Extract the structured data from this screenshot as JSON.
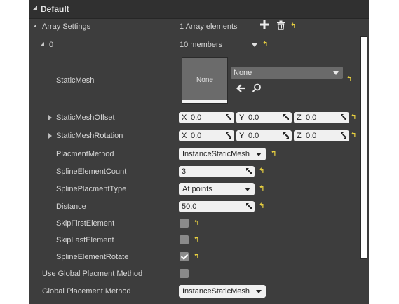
{
  "category": {
    "title": "Default"
  },
  "array_settings": {
    "label": "Array Settings",
    "count_text": "1 Array elements"
  },
  "element0": {
    "label": "0",
    "members_text": "10 members"
  },
  "static_mesh": {
    "label": "StaticMesh",
    "thumbnail_text": "None",
    "selected": "None"
  },
  "offset": {
    "label": "StaticMeshOffset",
    "x_axis": "X",
    "x": "0.0",
    "y_axis": "Y",
    "y": "0.0",
    "z_axis": "Z",
    "z": "0.0"
  },
  "rotation": {
    "label": "StaticMeshRotation",
    "x_axis": "X",
    "x": "0.0",
    "y_axis": "Y",
    "y": "0.0",
    "z_axis": "Z",
    "z": "0.0"
  },
  "placment_method": {
    "label": "PlacmentMethod",
    "value": "InstanceStaticMesh"
  },
  "spline_element_count": {
    "label": "SplineElementCount",
    "value": "3"
  },
  "spline_placment_type": {
    "label": "SplinePlacmentType",
    "value": "At points"
  },
  "distance": {
    "label": "Distance",
    "value": "50.0"
  },
  "skip_first": {
    "label": "SkipFirstElement",
    "checked": false
  },
  "skip_last": {
    "label": "SkipLastElement",
    "checked": false
  },
  "spline_rotate": {
    "label": "SplineElementRotate",
    "checked": true
  },
  "use_global": {
    "label": "Use Global Placment Method",
    "checked": false
  },
  "global_method": {
    "label": "Global Placement Method",
    "value": "InstanceStaticMesh"
  },
  "icons": {
    "reset": "reset-to-default-icon",
    "add": "plus-icon",
    "delete": "trash-icon",
    "use_selected": "arrow-left-icon",
    "browse": "magnifier-icon"
  },
  "colors": {
    "panel_bg": "#3d3d3d",
    "header_bg": "#303030",
    "reset_yellow": "#e8d040",
    "field_bg": "#f0f0f0"
  }
}
